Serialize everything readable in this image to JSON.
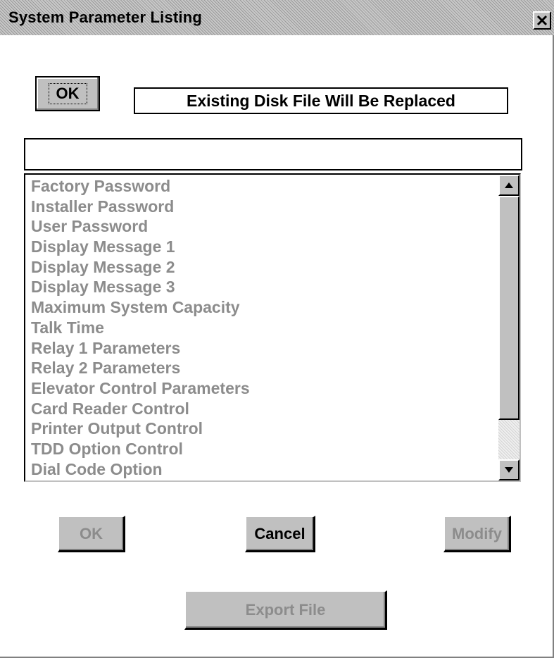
{
  "window": {
    "title": "System Parameter Listing",
    "close_glyph": "✕",
    "close_icon": "close-icon"
  },
  "top_ok_button": {
    "label": "OK"
  },
  "status_message": "Existing Disk File Will Be Replaced",
  "text_field": {
    "value": ""
  },
  "parameter_list": {
    "items": [
      "Factory Password",
      "Installer Password",
      "User Password",
      "Display Message 1",
      "Display Message 2",
      "Display Message 3",
      "Maximum System Capacity",
      "Talk Time",
      "Relay 1 Parameters",
      "Relay 2 Parameters",
      "Elevator Control Parameters",
      "Card Reader Control",
      "Printer Output Control",
      "TDD Option Control",
      "Dial Code Option"
    ],
    "scroll_up_icon": "arrow-up-icon",
    "scroll_down_icon": "arrow-down-icon"
  },
  "buttons": {
    "ok_label": "OK",
    "ok_enabled": false,
    "cancel_label": "Cancel",
    "cancel_enabled": true,
    "modify_label": "Modify",
    "modify_enabled": false,
    "export_label": "Export File",
    "export_enabled": false
  },
  "colors": {
    "disabled_text": "#8c8c8c",
    "face": "#c0c0c0"
  }
}
